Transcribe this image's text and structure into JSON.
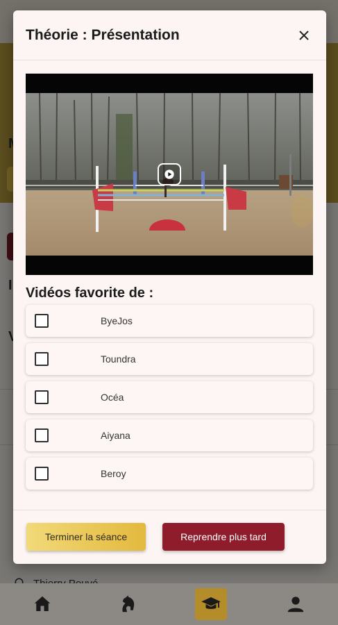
{
  "background": {
    "search_text": "Thierry Pouvé",
    "letters": [
      "M",
      "I",
      "V"
    ]
  },
  "modal": {
    "title": "Théorie : Présentation",
    "close_icon": "close-icon",
    "video": {
      "play_icon": "play-circle-icon"
    },
    "favorites_heading": "Vidéos favorite de :",
    "riders": [
      {
        "name": "ByeJos",
        "checked": false
      },
      {
        "name": "Toundra",
        "checked": false
      },
      {
        "name": "Océa",
        "checked": false
      },
      {
        "name": "Aiyana",
        "checked": false
      },
      {
        "name": "Beroy",
        "checked": false
      }
    ],
    "buttons": {
      "finish": "Terminer la séance",
      "later": "Reprendre plus tard"
    }
  },
  "nav": {
    "items": [
      {
        "icon": "home-icon",
        "active": false
      },
      {
        "icon": "horse-icon",
        "active": false
      },
      {
        "icon": "graduation-cap-icon",
        "active": true
      },
      {
        "icon": "user-icon",
        "active": false
      }
    ]
  },
  "colors": {
    "accent_gold": "#e3b93e",
    "accent_red": "#8f1c2a",
    "modal_bg": "#fcf5f3"
  }
}
